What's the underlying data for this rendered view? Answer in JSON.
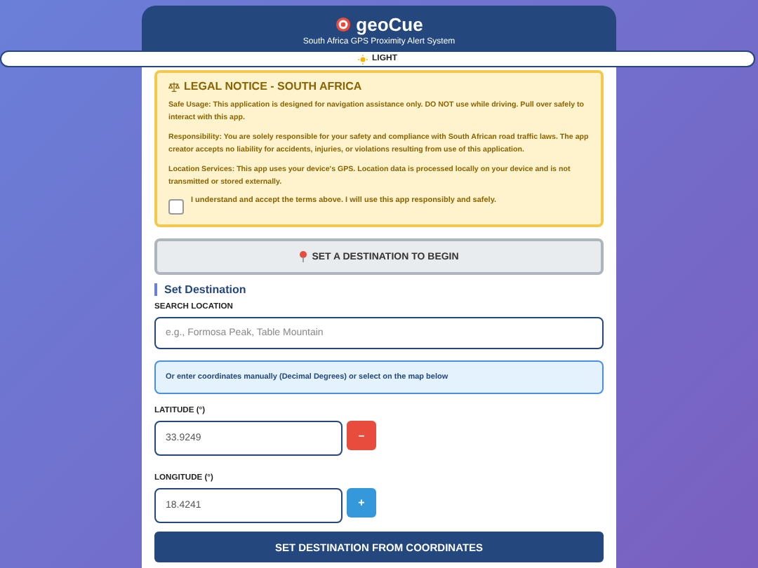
{
  "header": {
    "title": "geoCue",
    "subtitle": "South Africa GPS Proximity Alert System"
  },
  "theme_toggle": {
    "label": "LIGHT"
  },
  "legal_notice": {
    "title": "LEGAL NOTICE - SOUTH AFRICA",
    "paragraphs": [
      "Safe Usage: This application is designed for navigation assistance only. DO NOT use while driving. Pull over safely to interact with this app.",
      "Responsibility: You are solely responsible for your safety and compliance with South African road traffic laws. The app creator accepts no liability for accidents, injuries, or violations resulting from use of this application.",
      "Location Services: This app uses your device's GPS. Location data is processed locally on your device and is not transmitted or stored externally."
    ],
    "accept": {
      "label": "I understand and accept the terms above. I will use this app responsibly and safely.",
      "checked": false
    }
  },
  "status_button": {
    "label": "SET A DESTINATION TO BEGIN",
    "disabled": true
  },
  "destination": {
    "title": "Set Destination",
    "search_label": "SEARCH LOCATION",
    "search_placeholder": "e.g., Formosa Peak, Table Mountain",
    "info": "Or enter coordinates manually (Decimal Degrees) or select on the map below",
    "coordinates": [
      {
        "label": "LATITUDE (°)",
        "value": "33.9249",
        "sign": "–",
        "kind": "negative"
      },
      {
        "label": "LONGITUDE (°)",
        "value": "18.4241",
        "sign": "+",
        "kind": "positive"
      }
    ],
    "submit": "SET DESTINATION FROM COORDINATES"
  }
}
